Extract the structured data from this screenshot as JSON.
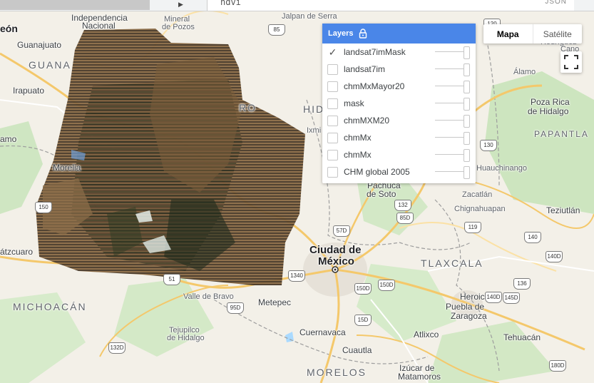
{
  "toolbar": {
    "code_variable": "ndvi",
    "format_label": "JSON"
  },
  "layers_panel": {
    "title": "Layers",
    "items": [
      {
        "name": "landsat7imMask",
        "checked": true
      },
      {
        "name": "landsat7im",
        "checked": false
      },
      {
        "name": "chmMxMayor20",
        "checked": false
      },
      {
        "name": "mask",
        "checked": false
      },
      {
        "name": "chmMXM20",
        "checked": false
      },
      {
        "name": "chmMx",
        "checked": false
      },
      {
        "name": "chmMx",
        "checked": false
      },
      {
        "name": "CHM global 2005",
        "checked": false
      }
    ]
  },
  "map_type": {
    "map_label": "Mapa",
    "satellite_label": "Satélite",
    "active": "map"
  },
  "map_labels": {
    "independencia": "Independencia",
    "nacional": "Nacional",
    "mineral": "Mineral",
    "de_pozos": "de Pozos",
    "jalpan": "Jalpan de Serra",
    "leon": "eón",
    "guanajuato": "Guanajuato",
    "guana": "GUANA",
    "irapuato": "Irapuato",
    "amo": "amo",
    "morelia": "Morelia",
    "atzcuaro": "átzcuaro",
    "michoacan": "MICHOACÁN",
    "valle_de_bravo": "Valle de Bravo",
    "tejupilco": "Tejupilco",
    "de_hidalgo": "de Hidalgo",
    "metepec": "Metepec",
    "ciudad_de": "Ciudad de",
    "mexico": "México",
    "cuernavaca": "Cuernavaca",
    "cuautla": "Cuautla",
    "morelos": "MORELOS",
    "pachuca": "Pachuca",
    "de_soto": "de Soto",
    "hid": "HID",
    "ixmi": "Ixmi",
    "tlaxcala": "TLAXCALA",
    "heroica": "Heroica",
    "puebla_de": "Puebla de",
    "zaragoza": "Zaragoza",
    "atlixco": "Atlixco",
    "izucar": "Izúcar de",
    "matamoros": "Matamoros",
    "tehuacan": "Tehuacán",
    "zacatlan": "Zacatlán",
    "chignahuapan": "Chignahuapan",
    "teziutlan": "Teziutlán",
    "huauchinango": "Huauchinango",
    "poza_rica": "Poza Rica",
    "de_hidalgo2": "de Hidalgo",
    "papantla": "PAPANTLA",
    "alamo": "Álamo",
    "rodriguez": "Rodríguez",
    "cano": "Cano",
    "ro": "RO"
  },
  "road_shields": [
    "85",
    "130",
    "120",
    "132",
    "85D",
    "57D",
    "119",
    "150",
    "51",
    "1340",
    "15D",
    "150D",
    "136",
    "140D",
    "140",
    "145D",
    "150D",
    "95D",
    "132D",
    "140D",
    "180D"
  ],
  "colors": {
    "accent": "#4a86e8"
  }
}
